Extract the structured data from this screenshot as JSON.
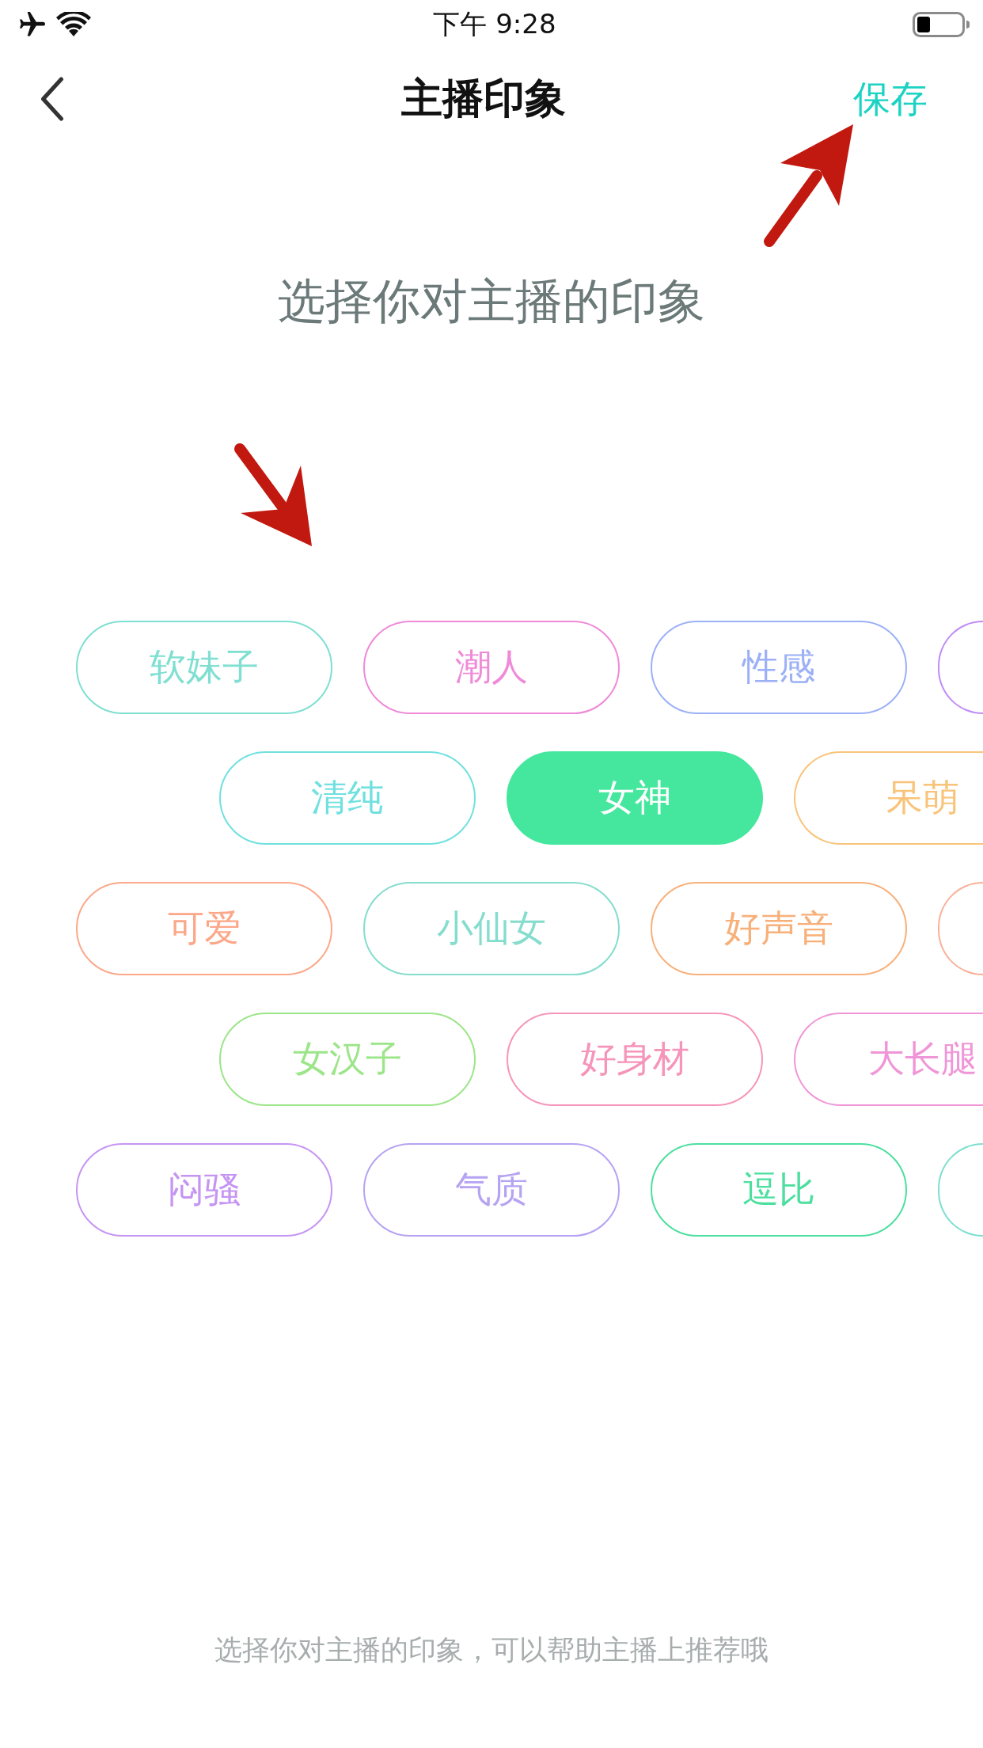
{
  "status_bar": {
    "time": "下午 9:28"
  },
  "nav": {
    "title": "主播印象",
    "action": "保存"
  },
  "heading": "选择你对主播的印象",
  "tag_rows": [
    {
      "tags": [
        {
          "label": "软妹子",
          "color": "#7fdfd1",
          "selected": false
        },
        {
          "label": "潮人",
          "color": "#ef8ad8",
          "selected": false
        },
        {
          "label": "性感",
          "color": "#9cb0f7",
          "selected": false
        },
        {
          "color": "#c08cf6",
          "selected": false
        }
      ]
    },
    {
      "tags": [
        {
          "label": "清纯",
          "color": "#70e0e0",
          "selected": false
        },
        {
          "label": "女神",
          "color": "#44e79d",
          "selected": true
        },
        {
          "label": "呆萌",
          "color": "#f8c47a",
          "selected": false
        }
      ]
    },
    {
      "tags": [
        {
          "label": "可爱",
          "color": "#fba88a",
          "selected": false
        },
        {
          "label": "小仙女",
          "color": "#84ddcd",
          "selected": false
        },
        {
          "label": "好声音",
          "color": "#f8b07a",
          "selected": false
        },
        {
          "color": "#f9b199",
          "selected": false
        }
      ]
    },
    {
      "tags": [
        {
          "label": "女汉子",
          "color": "#9ce589",
          "selected": false
        },
        {
          "label": "好身材",
          "color": "#f695ba",
          "selected": false
        },
        {
          "label": "大长腿",
          "color": "#f096d8",
          "selected": false
        }
      ]
    },
    {
      "tags": [
        {
          "label": "闷骚",
          "color": "#c695f3",
          "selected": false
        },
        {
          "label": "气质",
          "color": "#b6a3f2",
          "selected": false
        },
        {
          "label": "逗比",
          "color": "#4ddf9f",
          "selected": false
        },
        {
          "color": "#7ddfcf",
          "selected": false
        }
      ]
    }
  ],
  "footer_hint": "选择你对主播的印象，可以帮助主播上推荐哦"
}
